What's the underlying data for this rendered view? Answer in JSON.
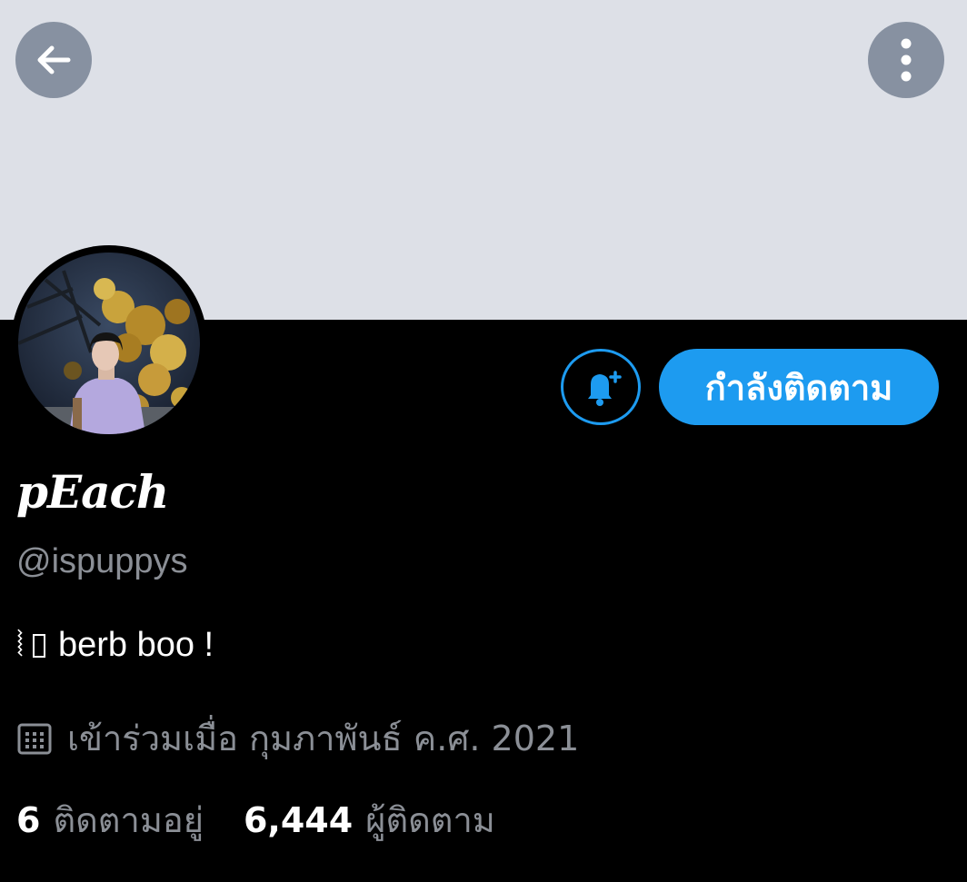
{
  "header": {
    "back_icon": "arrow-left-icon",
    "more_icon": "more-vertical-icon"
  },
  "profile": {
    "display_name": "pEach",
    "handle": "@ispuppys",
    "bio_prefix": "⦚",
    "bio_text": "berb boo !",
    "joined": "เข้าร่วมเมื่อ กุมภาพันธ์ ค.ศ. 2021",
    "joined_icon": "calendar-icon"
  },
  "actions": {
    "notify_icon": "bell-plus-icon",
    "follow_label": "กำลังติดตาม"
  },
  "stats": {
    "following_count": "6",
    "following_label": "ติดตามอยู่",
    "followers_count": "6,444",
    "followers_label": "ผู้ติดตาม"
  },
  "colors": {
    "accent": "#1d9bf0",
    "banner": "#dde0e7",
    "background": "#000000",
    "muted_text": "#8b8f96"
  }
}
